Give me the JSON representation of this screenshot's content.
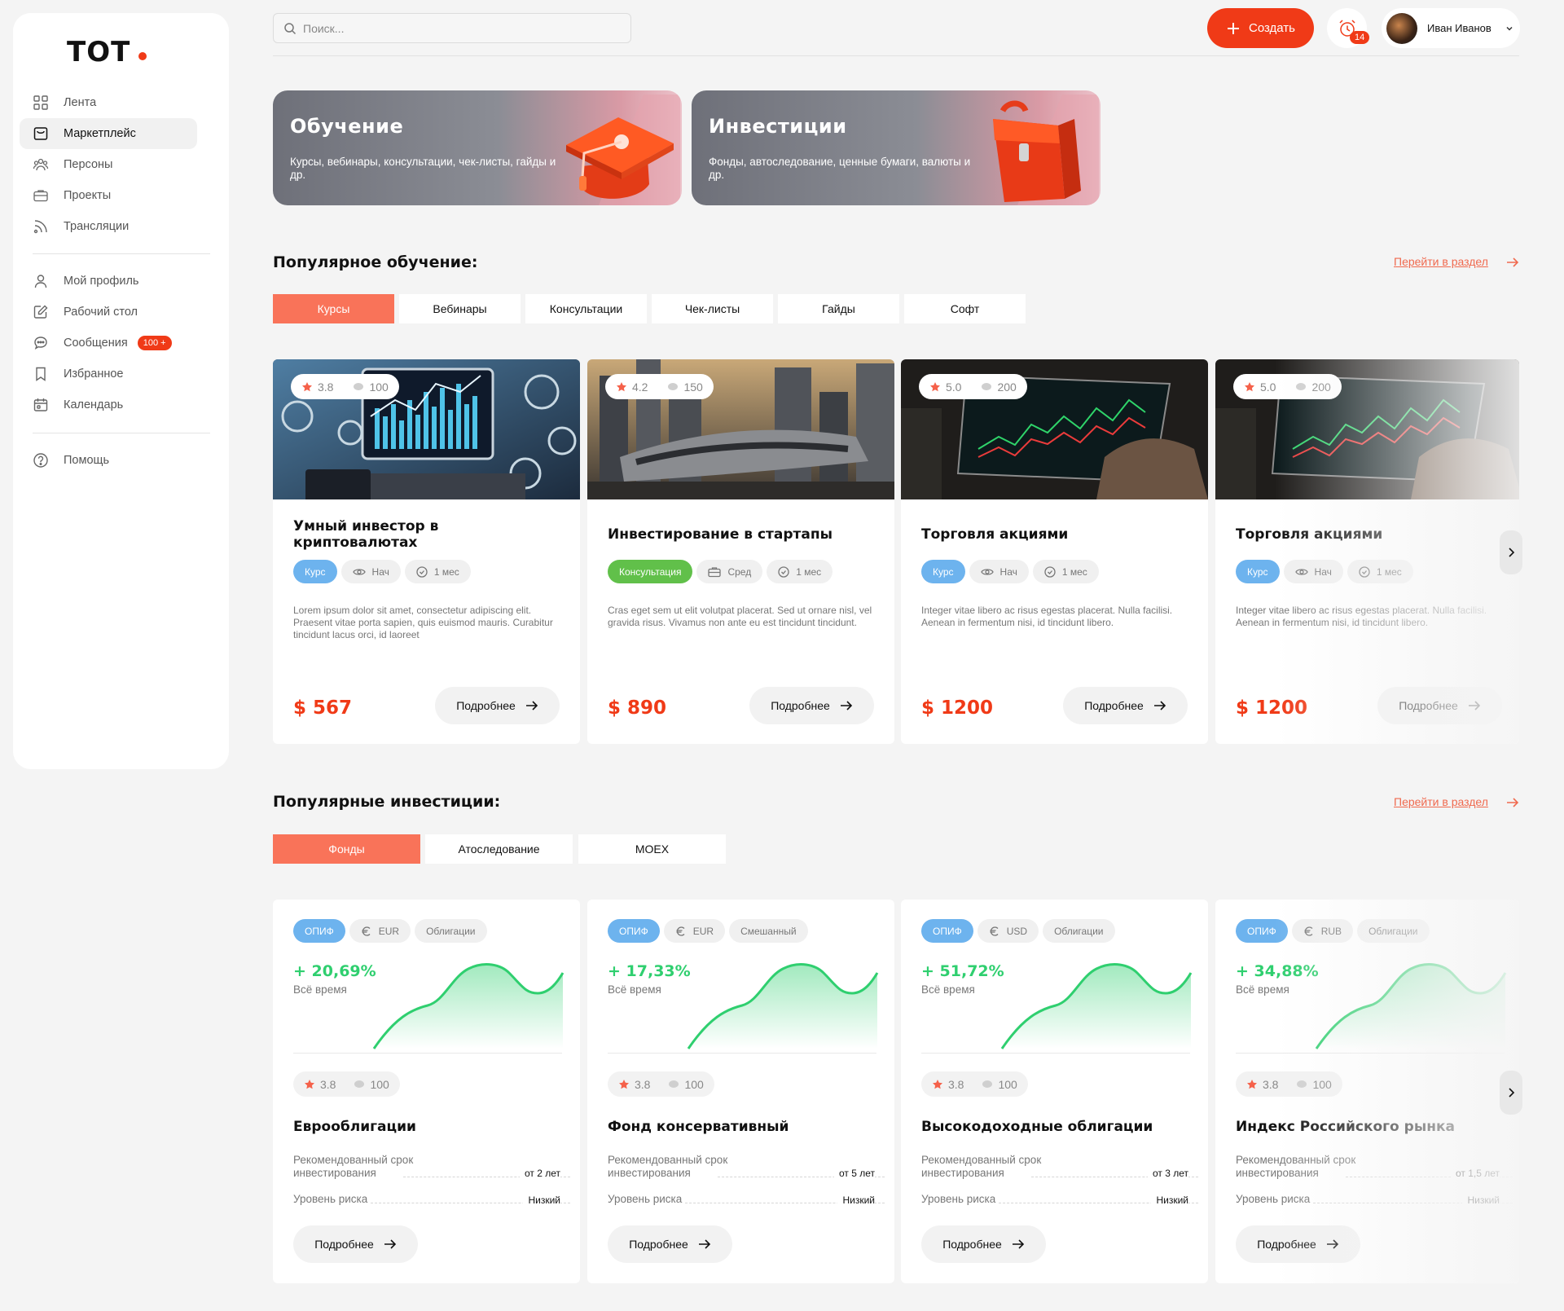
{
  "app": {
    "logo": "TOT"
  },
  "sidebar": {
    "items": [
      {
        "label": "Лента",
        "icon": "grid-icon"
      },
      {
        "label": "Маркетплейс",
        "icon": "shopping-bag-icon"
      },
      {
        "label": "Персоны",
        "icon": "people-icon"
      },
      {
        "label": "Проекты",
        "icon": "briefcase-icon"
      },
      {
        "label": "Трансляции",
        "icon": "broadcast-icon"
      }
    ],
    "items2": [
      {
        "label": "Мой профиль",
        "icon": "user-icon"
      },
      {
        "label": "Рабочий стол",
        "icon": "edit-icon"
      },
      {
        "label": "Сообщения",
        "icon": "chat-icon",
        "badge": "100 +"
      },
      {
        "label": "Избранное",
        "icon": "bookmark-icon"
      },
      {
        "label": "Календарь",
        "icon": "calendar-icon"
      }
    ],
    "items3": [
      {
        "label": "Помощь",
        "icon": "help-icon"
      }
    ]
  },
  "header": {
    "search_placeholder": "Поиск...",
    "create_label": "Создать",
    "notifications_count": "14",
    "user_name": "Иван Иванов"
  },
  "banners": [
    {
      "title": "Обучение",
      "text": "Курсы, вебинары, консультации, чек-листы, гайды и др."
    },
    {
      "title": "Инвестиции",
      "text": "Фонды, автоследование, ценные бумаги, валюты и др."
    }
  ],
  "learning": {
    "title": "Популярное обучение:",
    "link": "Перейти в раздел",
    "tabs": [
      "Курсы",
      "Вебинары",
      "Консультации",
      "Чек-листы",
      "Гайды",
      "Софт"
    ],
    "cards": [
      {
        "rating": "3.8",
        "reviews": "100",
        "title": "Умный инвестор в криптовалютах",
        "type": "Курс",
        "level": "Нач",
        "duration": "1 мес",
        "desc": "Lorem ipsum dolor sit amet, consectetur adipiscing elit. Praesent vitae porta sapien, quis euismod mauris. Curabitur tincidunt lacus orci, id laoreet",
        "price": "$ 567",
        "more": "Подробнее"
      },
      {
        "rating": "4.2",
        "reviews": "150",
        "title": "Инвестирование в стартапы",
        "type": "Консультация",
        "level": "Сред",
        "duration": "1 мес",
        "desc": "Cras eget sem ut elit volutpat placerat. Sed ut ornare nisl, vel gravida risus. Vivamus non ante eu est tincidunt tincidunt.",
        "price": "$ 890",
        "more": "Подробнее"
      },
      {
        "rating": "5.0",
        "reviews": "200",
        "title": "Торговля акциями",
        "type": "Курс",
        "level": "Нач",
        "duration": "1 мес",
        "desc": "Integer vitae libero ac risus egestas placerat. Nulla facilisi. Aenean in fermentum nisi, id tincidunt libero.",
        "price": "$ 1200",
        "more": "Подробнее"
      },
      {
        "rating": "5.0",
        "reviews": "200",
        "title": "Торговля акциями",
        "type": "Курс",
        "level": "Нач",
        "duration": "1 мес",
        "desc": "Integer vitae libero ac risus egestas placerat. Nulla facilisi. Aenean in fermentum nisi, id tincidunt libero.",
        "price": "$ 1200",
        "more": "Подробнее"
      }
    ]
  },
  "investments": {
    "title": "Популярные инвестиции:",
    "link": "Перейти в раздел",
    "tabs": [
      "Фонды",
      "Атоследование",
      "MOEX"
    ],
    "cards": [
      {
        "type": "ОПИФ",
        "currency": "EUR",
        "kind": "Облигации",
        "gain": "+ 20,69%",
        "period": "Всё время",
        "rating": "3.8",
        "reviews": "100",
        "title": "Еврооблигации",
        "term_label": "Рекомендованный срок инвестирования",
        "term": "от 2 лет",
        "risk_label": "Уровень риска",
        "risk": "Низкий",
        "more": "Подробнее"
      },
      {
        "type": "ОПИФ",
        "currency": "EUR",
        "kind": "Смешанный",
        "gain": "+ 17,33%",
        "period": "Всё время",
        "rating": "3.8",
        "reviews": "100",
        "title": "Фонд консервативный",
        "term_label": "Рекомендованный срок инвестирования",
        "term": "от 5 лет",
        "risk_label": "Уровень риска",
        "risk": "Низкий",
        "more": "Подробнее"
      },
      {
        "type": "ОПИФ",
        "currency": "USD",
        "kind": "Облигации",
        "gain": "+ 51,72%",
        "period": "Всё время",
        "rating": "3.8",
        "reviews": "100",
        "title": "Высокодоходные облигации",
        "term_label": "Рекомендованный срок инвестирования",
        "term": "от 3 лет",
        "risk_label": "Уровень риска",
        "risk": "Низкий",
        "more": "Подробнее"
      },
      {
        "type": "ОПИФ",
        "currency": "RUB",
        "kind": "Облигации",
        "gain": "+ 34,88%",
        "period": "Всё время",
        "rating": "3.8",
        "reviews": "100",
        "title": "Индекс Российского рынка",
        "term_label": "Рекомендованный срок инвестирования",
        "term": "от 1,5 лет",
        "risk_label": "Уровень риска",
        "risk": "Низкий",
        "more": "Подробнее"
      }
    ]
  },
  "colors": {
    "accent": "#f03a17",
    "tab_active": "#f97359",
    "gain": "#2fcf6f",
    "tag_blue": "#6db3ee",
    "tag_green": "#61c04a"
  }
}
